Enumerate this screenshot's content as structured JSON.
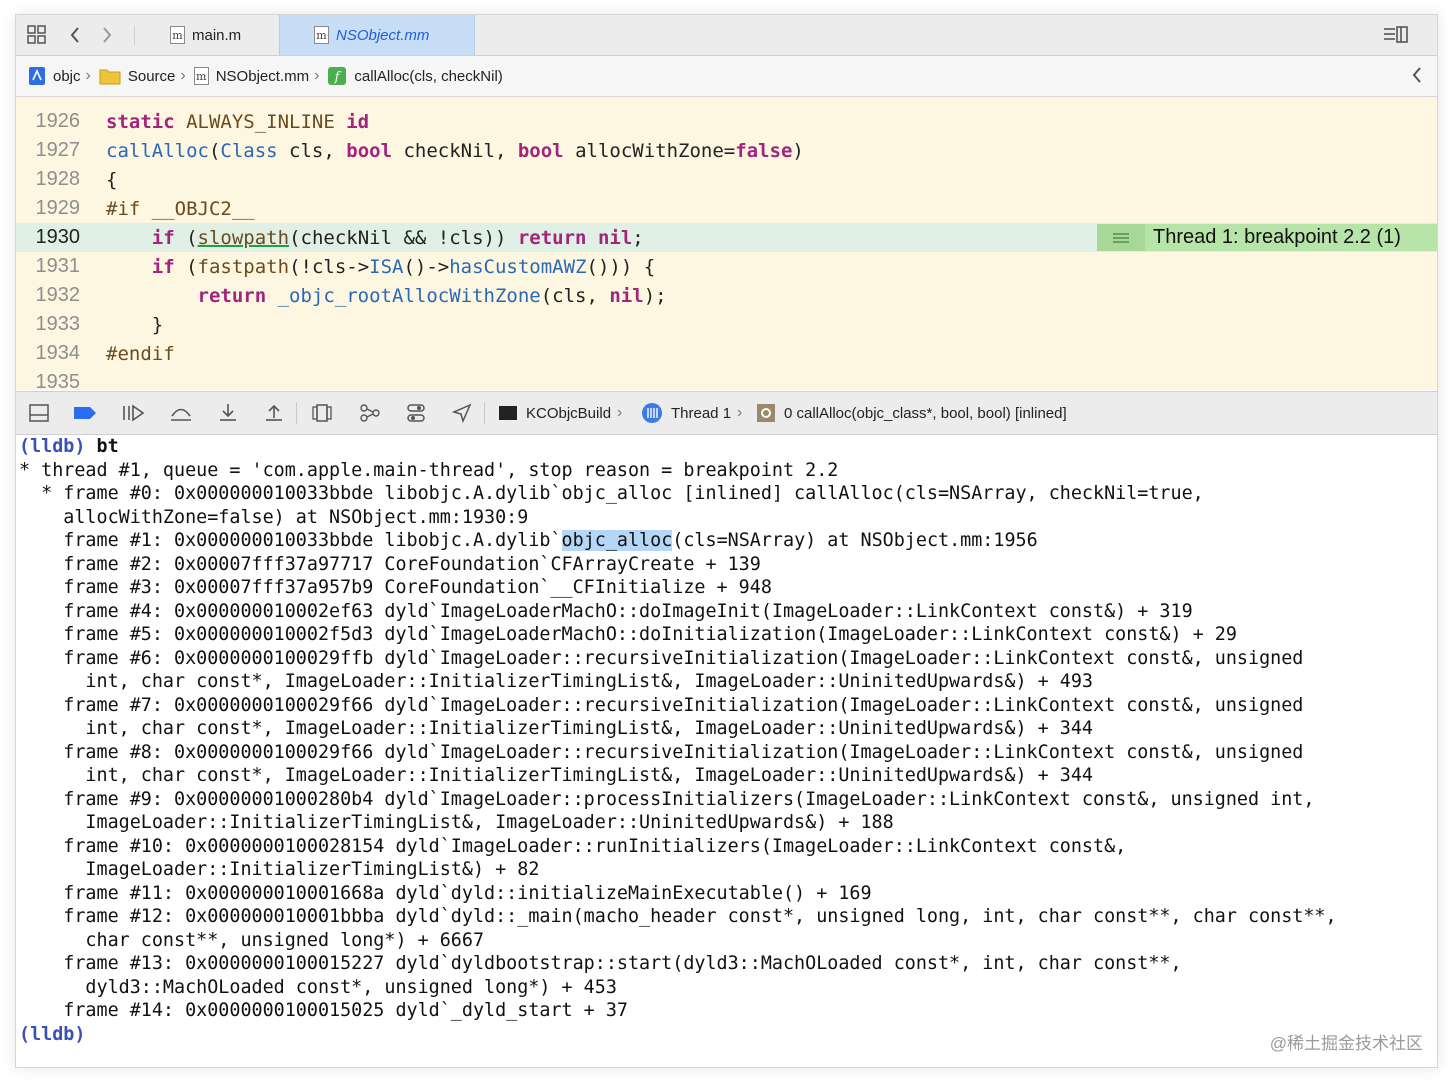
{
  "tabs": [
    {
      "label": "main.m",
      "icon": "m",
      "active": false
    },
    {
      "label": "NSObject.mm",
      "icon": "m",
      "active": true
    }
  ],
  "breadcrumb": [
    {
      "label": "objc",
      "icon": "project-icon"
    },
    {
      "label": "Source",
      "icon": "folder-icon"
    },
    {
      "label": "NSObject.mm",
      "icon": "m"
    },
    {
      "label": "callAlloc(cls, checkNil)",
      "icon": "function-icon"
    }
  ],
  "editor": {
    "lines": [
      {
        "num": "1926"
      },
      {
        "num": "1927"
      },
      {
        "num": "1928"
      },
      {
        "num": "1929"
      },
      {
        "num": "1930"
      },
      {
        "num": "1931"
      },
      {
        "num": "1932"
      },
      {
        "num": "1933"
      },
      {
        "num": "1934"
      },
      {
        "num": "1935"
      }
    ],
    "code": {
      "l1926_a": "static",
      "l1926_b": " ALWAYS_INLINE ",
      "l1926_c": "id",
      "l1927_a": "callAlloc",
      "l1927_b": "(",
      "l1927_c": "Class",
      "l1927_d": " cls, ",
      "l1927_e": "bool",
      "l1927_f": " checkNil, ",
      "l1927_g": "bool",
      "l1927_h": " allocWithZone=",
      "l1927_i": "false",
      "l1927_j": ")",
      "l1928": "{",
      "l1929": "#if __OBJC2__",
      "l1930_a": "    ",
      "l1930_b": "if",
      "l1930_c": " (",
      "l1930_d": "slowpath",
      "l1930_e": "(checkNil && !cls)) ",
      "l1930_f": "return",
      "l1930_g": " ",
      "l1930_h": "nil",
      "l1930_i": ";",
      "l1931_a": "    ",
      "l1931_b": "if",
      "l1931_c": " (",
      "l1931_d": "fastpath",
      "l1931_e": "(!cls->",
      "l1931_f": "ISA",
      "l1931_g": "()->",
      "l1931_h": "hasCustomAWZ",
      "l1931_i": "())) {",
      "l1932_a": "        ",
      "l1932_b": "return",
      "l1932_c": " ",
      "l1932_d": "_objc_rootAllocWithZone",
      "l1932_e": "(cls, ",
      "l1932_f": "nil",
      "l1932_g": ");",
      "l1933": "    }",
      "l1934": "#endif"
    },
    "breakpoint_banner": "Thread 1: breakpoint 2.2 (1)"
  },
  "debug_bar": {
    "target": "KCObjcBuild",
    "thread": "Thread 1",
    "frame": "0 callAlloc(objc_class*, bool, bool) [inlined]"
  },
  "console": {
    "prompt": "(lldb)",
    "command": " bt",
    "lines": [
      "* thread #1, queue = 'com.apple.main-thread', stop reason = breakpoint 2.2",
      "  * frame #0: 0x000000010033bbde libobjc.A.dylib`objc_alloc [inlined] callAlloc(cls=NSArray, checkNil=true,",
      "    allocWithZone=false) at NSObject.mm:1930:9",
      "",
      "    frame #2: 0x00007fff37a97717 CoreFoundation`CFArrayCreate + 139",
      "    frame #3: 0x00007fff37a957b9 CoreFoundation`__CFInitialize + 948",
      "    frame #4: 0x000000010002ef63 dyld`ImageLoaderMachO::doImageInit(ImageLoader::LinkContext const&) + 319",
      "    frame #5: 0x000000010002f5d3 dyld`ImageLoaderMachO::doInitialization(ImageLoader::LinkContext const&) + 29",
      "    frame #6: 0x0000000100029ffb dyld`ImageLoader::recursiveInitialization(ImageLoader::LinkContext const&, unsigned",
      "      int, char const*, ImageLoader::InitializerTimingList&, ImageLoader::UninitedUpwards&) + 493",
      "    frame #7: 0x0000000100029f66 dyld`ImageLoader::recursiveInitialization(ImageLoader::LinkContext const&, unsigned",
      "      int, char const*, ImageLoader::InitializerTimingList&, ImageLoader::UninitedUpwards&) + 344",
      "    frame #8: 0x0000000100029f66 dyld`ImageLoader::recursiveInitialization(ImageLoader::LinkContext const&, unsigned",
      "      int, char const*, ImageLoader::InitializerTimingList&, ImageLoader::UninitedUpwards&) + 344",
      "    frame #9: 0x00000001000280b4 dyld`ImageLoader::processInitializers(ImageLoader::LinkContext const&, unsigned int,",
      "      ImageLoader::InitializerTimingList&, ImageLoader::UninitedUpwards&) + 188",
      "    frame #10: 0x0000000100028154 dyld`ImageLoader::runInitializers(ImageLoader::LinkContext const&,",
      "      ImageLoader::InitializerTimingList&) + 82",
      "    frame #11: 0x000000010001668a dyld`dyld::initializeMainExecutable() + 169",
      "    frame #12: 0x000000010001bbba dyld`dyld::_main(macho_header const*, unsigned long, int, char const**, char const**,",
      "      char const**, unsigned long*) + 6667",
      "    frame #13: 0x0000000100015227 dyld`dyldbootstrap::start(dyld3::MachOLoaded const*, int, char const**,",
      "      dyld3::MachOLoaded const*, unsigned long*) + 453",
      "    frame #14: 0x0000000100015025 dyld`_dyld_start + 37"
    ],
    "frame1": {
      "prefix": "    frame #1: 0x000000010033bbde libobjc.A.dylib`",
      "highlight": "objc_alloc",
      "suffix": "(cls=NSArray) at NSObject.mm:1956"
    },
    "final_prompt": "(lldb)"
  },
  "watermark": "@稀土掘金技术社区"
}
